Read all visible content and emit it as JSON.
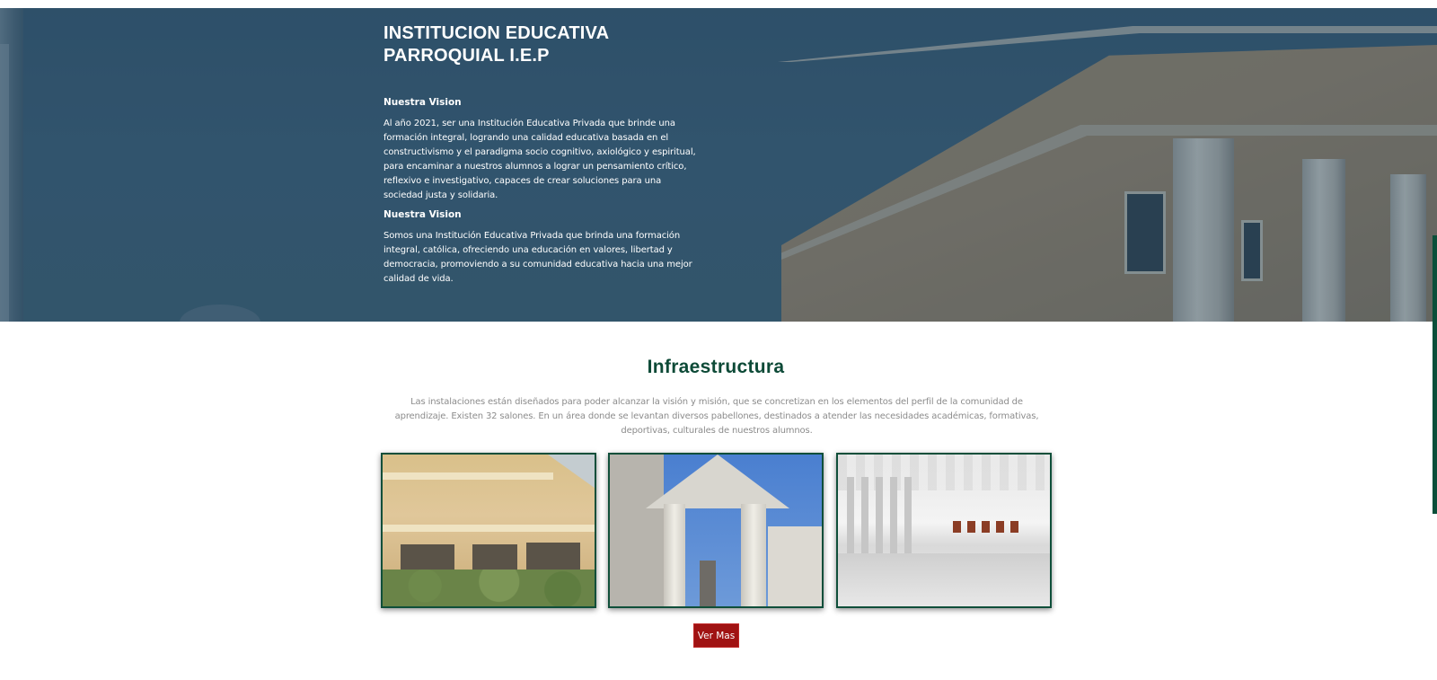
{
  "hero": {
    "title_line1": "INSTITUCION EDUCATIVA",
    "title_line2": "PARROQUIAL I.E.P",
    "section1_heading": "Nuestra Vision",
    "section1_text": "Al año 2021, ser una Institución Educativa Privada que brinde una formación integral, logrando una calidad educativa basada en el constructivismo y el paradigma socio cognitivo, axiológico y espiritual, para encaminar a nuestros alumnos a lograr un pensamiento crítico, reflexivo e investigativo, capaces de crear soluciones para una sociedad justa y solidaria.",
    "section2_heading": "Nuestra Vision",
    "section2_text": "Somos una Institución Educativa Privada que brinda una formación integral, católica, ofreciendo una educación en valores, libertad y democracia, promoviendo a su comunidad educativa hacia una mejor calidad de vida."
  },
  "infraestructura": {
    "title": "Infraestructura",
    "description": "Las instalaciones están diseñados para poder alcanzar la visión y misión, que se concretizan en los elementos del perfil de la comunidad de aprendizaje. Existen 32 salones. En un área donde se levantan diversos pabellones, destinados a atender las necesidades académicas, formativas, deportivas, culturales de nuestros alumnos.",
    "button_label": "Ver Mas"
  },
  "colors": {
    "brand_green": "#0d4a37",
    "button_red": "#a01313",
    "hero_overlay": "#34566f"
  }
}
